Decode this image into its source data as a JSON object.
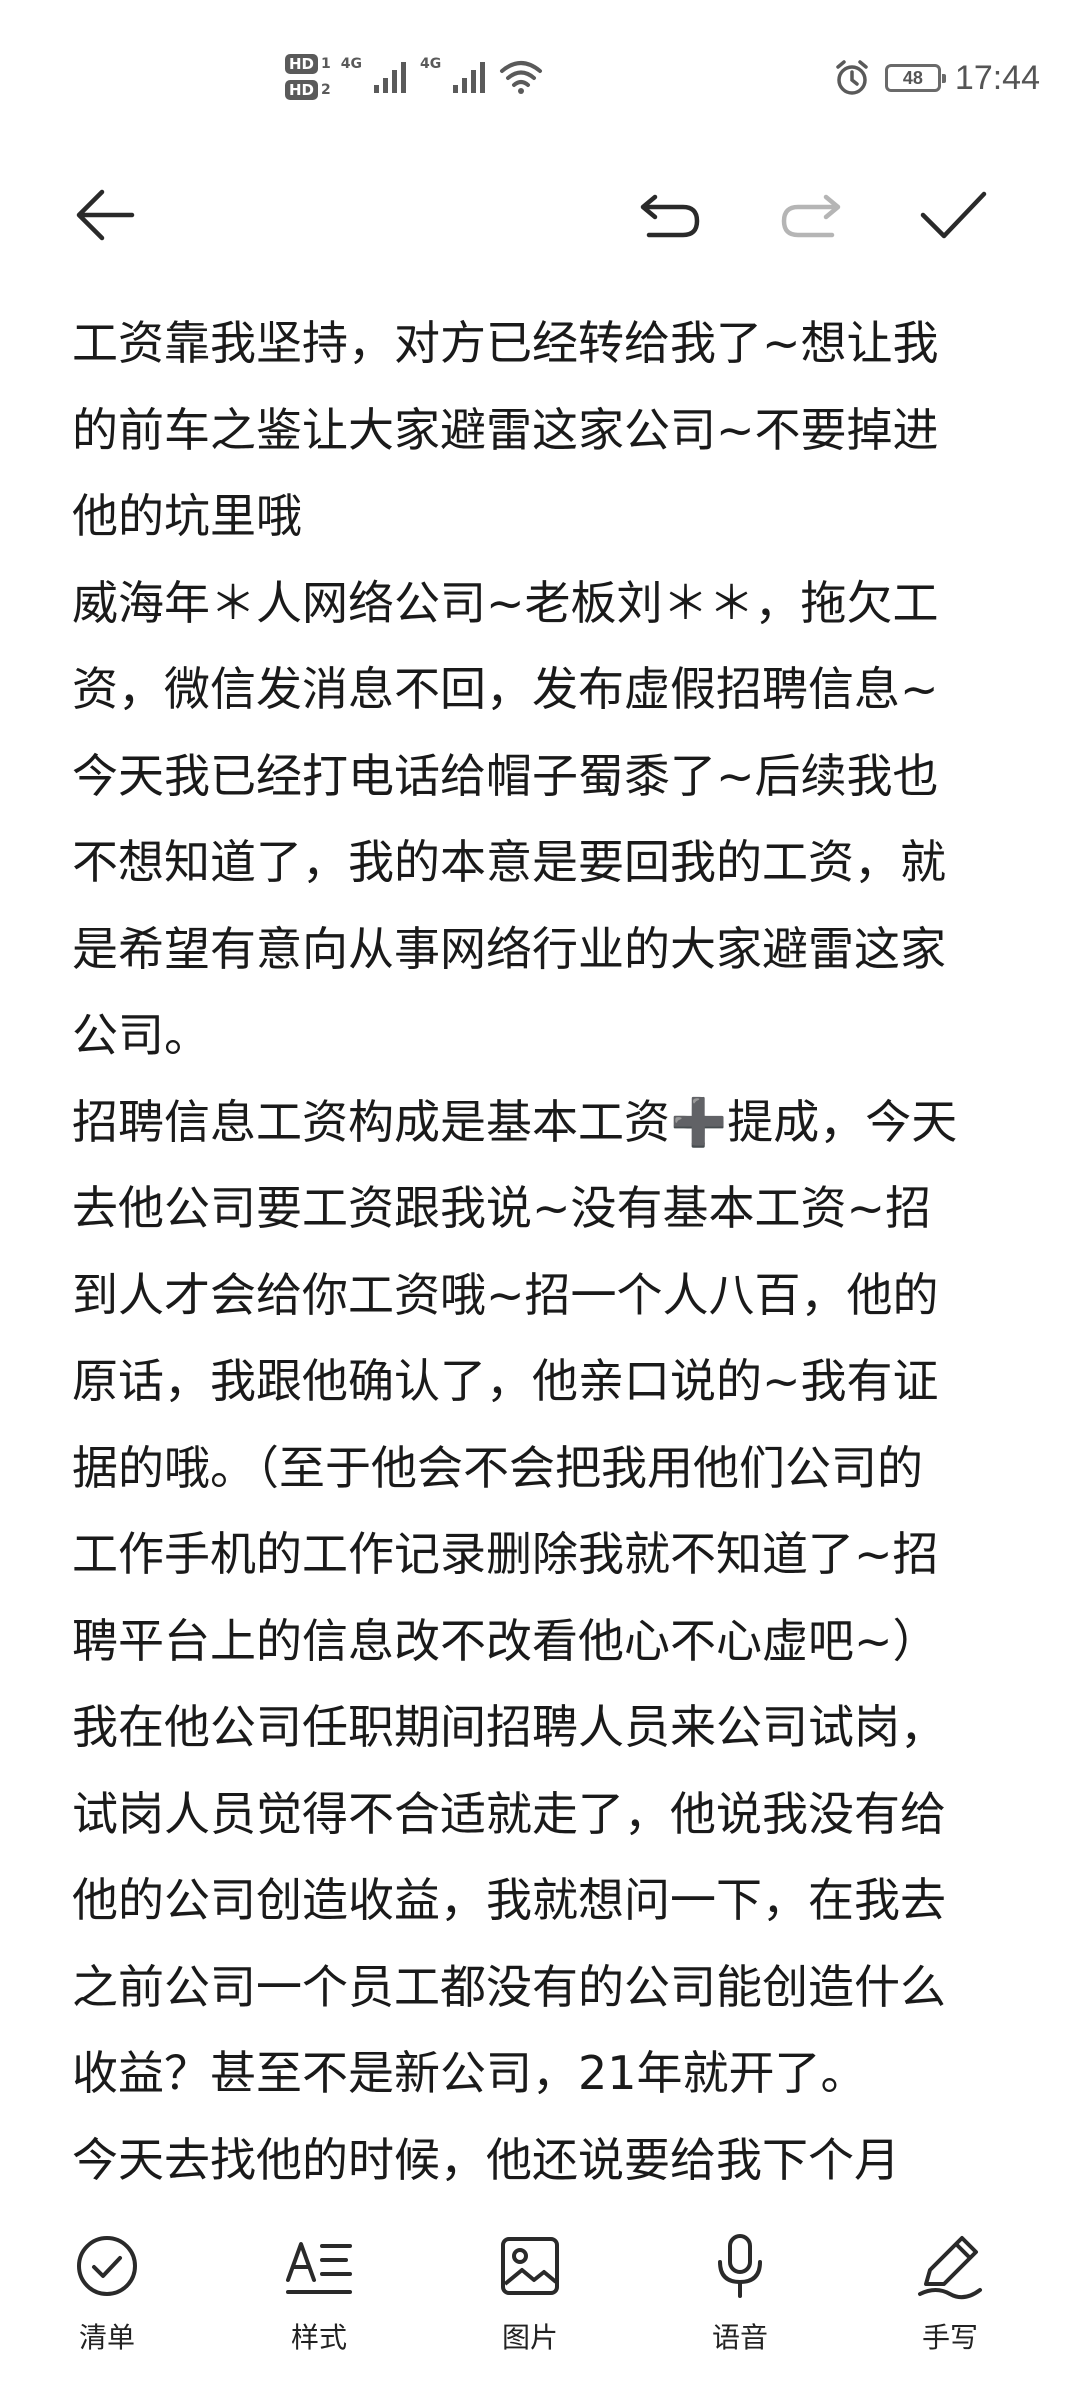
{
  "status_bar": {
    "hd1": "HD",
    "hd1_num": "1",
    "hd2": "HD",
    "hd2_num": "2",
    "net1": "4G",
    "net2": "4G",
    "battery": "48",
    "time": "17:44"
  },
  "note": {
    "lines": [
      "工资靠我坚持，对方已经转给我了~想让我",
      "的前车之鉴让大家避雷这家公司~不要掉进",
      "他的坑里哦",
      "威海年＊人网络公司~老板刘＊＊，拖欠工",
      "资，微信发消息不回，发布虚假招聘信息~",
      "今天我已经打电话给帽子蜀黍了~后续我也",
      "不想知道了，我的本意是要回我的工资，就",
      "是希望有意向从事网络行业的大家避雷这家",
      "公司。",
      "招聘信息工资构成是基本工资➕提成，今天",
      "去他公司要工资跟我说~没有基本工资~招",
      "到人才会给你工资哦~招一个人八百，他的",
      "原话，我跟他确认了，他亲口说的~我有证",
      "据的哦。（至于他会不会把我用他们公司的",
      "工作手机的工作记录删除我就不知道了~招",
      "聘平台上的信息改不改看他心不心虚吧~）",
      "我在他公司任职期间招聘人员来公司试岗，",
      "试岗人员觉得不合适就走了，他说我没有给",
      "他的公司创造收益，我就想问一下，在我去",
      "之前公司一个员工都没有的公司能创造什么",
      "收益？甚至不是新公司，21年就开了。",
      "今天去找他的时候，他还说要给我下个月"
    ]
  },
  "bottom_bar": {
    "list_label": "清单",
    "style_label": "样式",
    "image_label": "图片",
    "voice_label": "语音",
    "handwrite_label": "手写"
  },
  "colors": {
    "text": "#1a1a1a",
    "icon": "#2a2a2a",
    "icon_disabled": "#b5b5b5"
  }
}
